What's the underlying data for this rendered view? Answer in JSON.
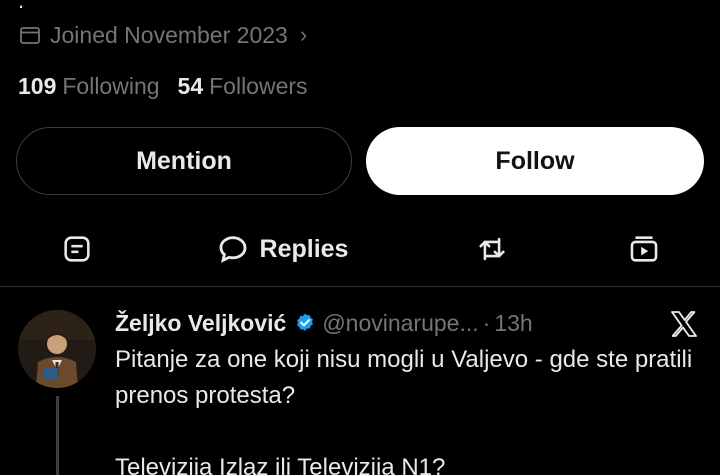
{
  "profile": {
    "joined": "Joined November 2023",
    "following_count": "109",
    "following_label": "Following",
    "followers_count": "54",
    "followers_label": "Followers"
  },
  "actions": {
    "mention_label": "Mention",
    "follow_label": "Follow"
  },
  "tabs": {
    "replies_label": "Replies",
    "active": "replies",
    "icons": [
      "posts-icon",
      "reply-bubble-icon",
      "repost-icon",
      "media-icon"
    ]
  },
  "tweet": {
    "name": "Željko Veljković",
    "handle": "@novinarupe...",
    "separator": "·",
    "time": "13h",
    "body_lines": [
      "Pitanje za one koji nisu mogli u Valjevo - gde ste pratili prenos protesta?",
      "Televizija Izlaz ili Televizija N1?"
    ]
  },
  "colors": {
    "background": "#000000",
    "text": "#e7e9ea",
    "muted": "#71767b",
    "verified": "#1d9bf0",
    "divider": "#2f3336"
  }
}
